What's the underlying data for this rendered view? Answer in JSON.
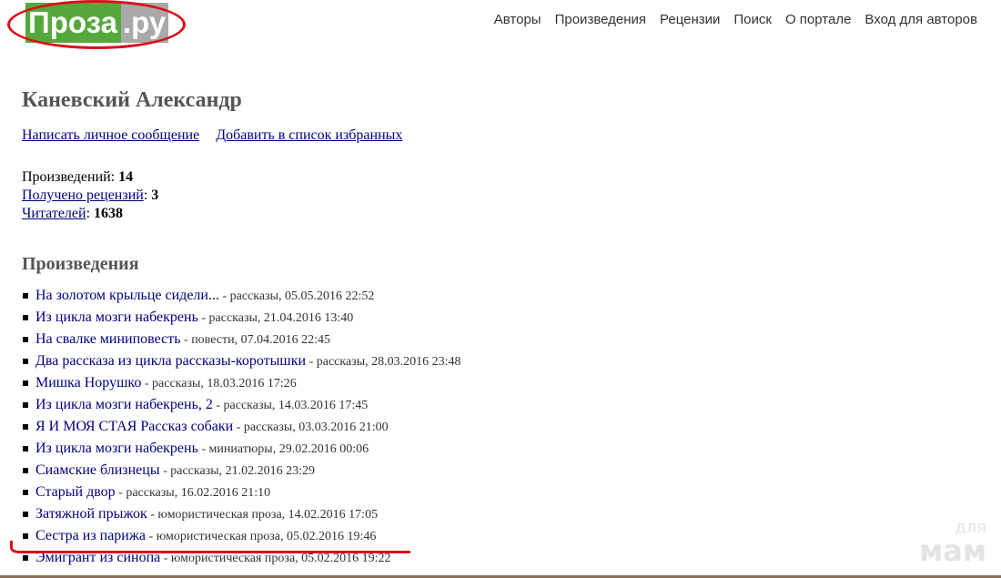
{
  "logo": {
    "part_a": "Проза",
    "part_b": ".ру"
  },
  "nav": {
    "items": [
      {
        "label": "Авторы"
      },
      {
        "label": "Произведения"
      },
      {
        "label": "Рецензии"
      },
      {
        "label": "Поиск"
      },
      {
        "label": "О портале"
      },
      {
        "label": "Вход для авторов"
      }
    ]
  },
  "author": {
    "name": "Каневский Александр",
    "links": {
      "message": "Написать личное сообщение",
      "favorites": "Добавить в список избранных"
    }
  },
  "stats": {
    "works_label": "Произведений",
    "works_value": "14",
    "reviews_label": "Получено рецензий",
    "reviews_value": "3",
    "readers_label": "Читателей",
    "readers_value": "1638"
  },
  "works_section": {
    "title": "Произведения",
    "items": [
      {
        "title": "На золотом крыльце сидели...",
        "meta": " - рассказы, 05.05.2016 22:52"
      },
      {
        "title": "Из цикла мозги набекрень",
        "meta": " - рассказы, 21.04.2016 13:40"
      },
      {
        "title": "На свалке миниповесть",
        "meta": " - повести, 07.04.2016 22:45"
      },
      {
        "title": "Два рассказа из цикла рассказы-коротышки",
        "meta": " - рассказы, 28.03.2016 23:48"
      },
      {
        "title": "Мишка Норушко",
        "meta": " - рассказы, 18.03.2016 17:26"
      },
      {
        "title": "Из цикла мозги набекрень, 2",
        "meta": " - рассказы, 14.03.2016 17:45"
      },
      {
        "title": "Я И МОЯ СТАЯ Рассказ собаки",
        "meta": " - рассказы, 03.03.2016 21:00"
      },
      {
        "title": "Из цикла мозги набекрень",
        "meta": " - миниатюры, 29.02.2016 00:06"
      },
      {
        "title": "Сиамские близнецы",
        "meta": " - рассказы, 21.02.2016 23:29"
      },
      {
        "title": "Старый двор",
        "meta": " - рассказы, 16.02.2016 21:10"
      },
      {
        "title": "Затяжной прыжок",
        "meta": " - юмористическая проза, 14.02.2016 17:05"
      },
      {
        "title": "Сестра из парижа",
        "meta": " - юмористическая проза, 05.02.2016 19:46"
      },
      {
        "title": "Эмигрант из синопа",
        "meta": " - юмористическая проза, 05.02.2016 19:22"
      }
    ]
  },
  "watermark": {
    "line1": "для",
    "line2": "мам"
  },
  "colors": {
    "link": "#000080",
    "logo_green": "#57a83c",
    "logo_gray": "#a9a9a9",
    "annotation_red": "#d9111b"
  }
}
